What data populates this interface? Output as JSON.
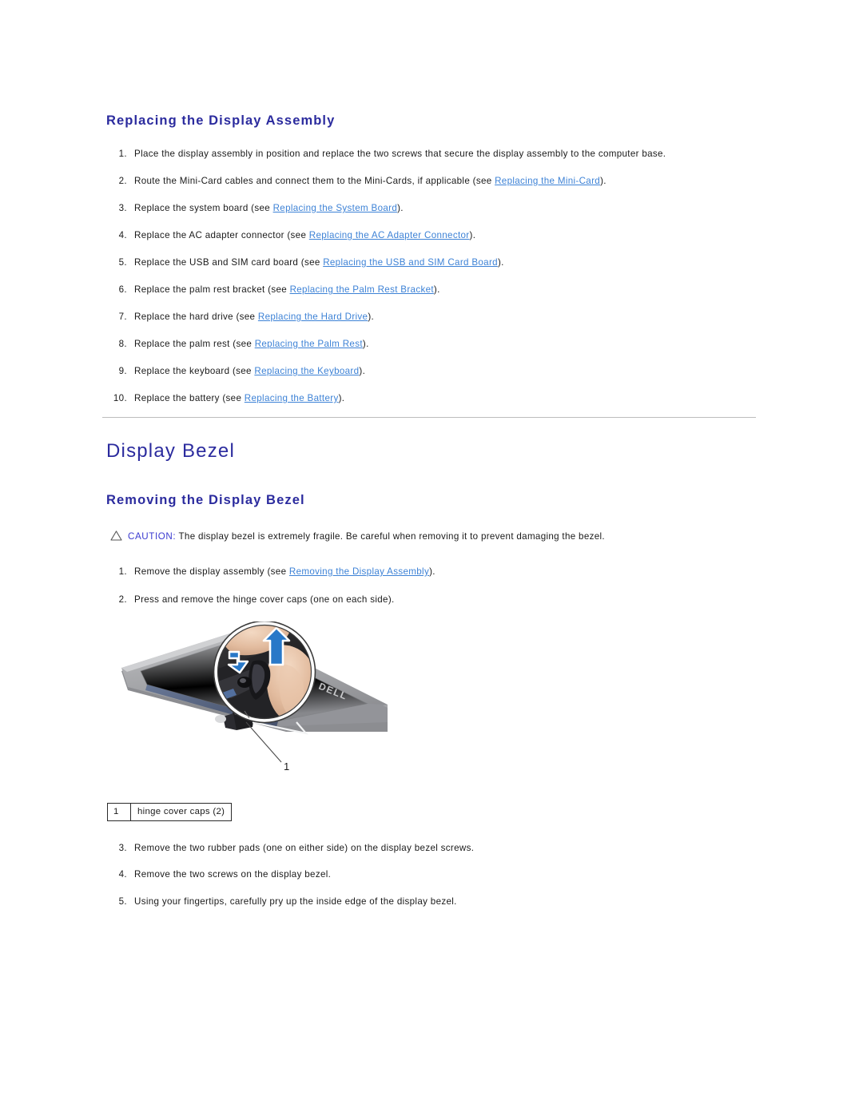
{
  "document": {
    "sections": [
      {
        "id": "replacing-display-assembly",
        "heading": "Replacing the Display Assembly",
        "steps": [
          {
            "num": "1.",
            "before": "Place the display assembly in position and replace the two screws that secure the display assembly to the computer base.",
            "link": "",
            "after": ""
          },
          {
            "num": "2.",
            "before": "Route the Mini-Card cables and connect them to the Mini-Cards, if applicable (see ",
            "link": "Replacing the Mini-Card",
            "after": ")."
          },
          {
            "num": "3.",
            "before": "Replace the system board (see ",
            "link": "Replacing the System Board",
            "after": ")."
          },
          {
            "num": "4.",
            "before": "Replace the AC adapter connector (see ",
            "link": "Replacing the AC Adapter Connector",
            "after": ")."
          },
          {
            "num": "5.",
            "before": "Replace the USB and SIM card board (see ",
            "link": "Replacing the USB and SIM Card Board",
            "after": ")."
          },
          {
            "num": "6.",
            "before": "Replace the palm rest bracket (see ",
            "link": "Replacing the Palm Rest Bracket",
            "after": ")."
          },
          {
            "num": "7.",
            "before": "Replace the hard drive (see ",
            "link": "Replacing the Hard Drive",
            "after": ")."
          },
          {
            "num": "8.",
            "before": "Replace the palm rest (see ",
            "link": "Replacing the Palm Rest",
            "after": ")."
          },
          {
            "num": "9.",
            "before": "Replace the keyboard (see ",
            "link": "Replacing the Keyboard",
            "after": ")."
          },
          {
            "num": "10.",
            "before": "Replace the battery (see ",
            "link": "Replacing the Battery",
            "after": ")."
          }
        ]
      },
      {
        "id": "display-bezel",
        "title": "Display Bezel",
        "heading": "Removing the Display Bezel",
        "caution": {
          "label": "CAUTION:",
          "text": " The display bezel is extremely fragile. Be careful when removing it to prevent damaging the bezel.",
          "icon": "warning-triangle-icon"
        },
        "steps_before_figure": [
          {
            "num": "1.",
            "before": "Remove the display assembly (see ",
            "link": "Removing the Display Assembly",
            "after": ")."
          },
          {
            "num": "2.",
            "before": "Press and remove the hinge cover caps (one on each side).",
            "link": "",
            "after": ""
          }
        ],
        "figure": {
          "callout_number": "1",
          "alt": "Laptop display lid corner with magnified view of finger removing hinge cover cap",
          "logo_text": "DELL"
        },
        "legend": [
          {
            "index": "1",
            "label": "hinge cover caps (2)"
          }
        ],
        "steps_after_figure": [
          {
            "num": "3.",
            "before": "Remove the two rubber pads (one on either side) on the display bezel screws.",
            "link": "",
            "after": ""
          },
          {
            "num": "4.",
            "before": "Remove the two screws on the display bezel.",
            "link": "",
            "after": ""
          },
          {
            "num": "5.",
            "before": "Using your fingertips, carefully pry up the inside edge of the display bezel.",
            "link": "",
            "after": ""
          }
        ]
      }
    ]
  },
  "colors": {
    "heading": "#2b2b9e",
    "link": "#3d82d6",
    "caution_label": "#3a3ad0",
    "rule": "#bdbdbd",
    "body_text": "#1a1a1a",
    "arrow_blue": "#2878c8",
    "lid_gray": "#9a9a9c"
  }
}
